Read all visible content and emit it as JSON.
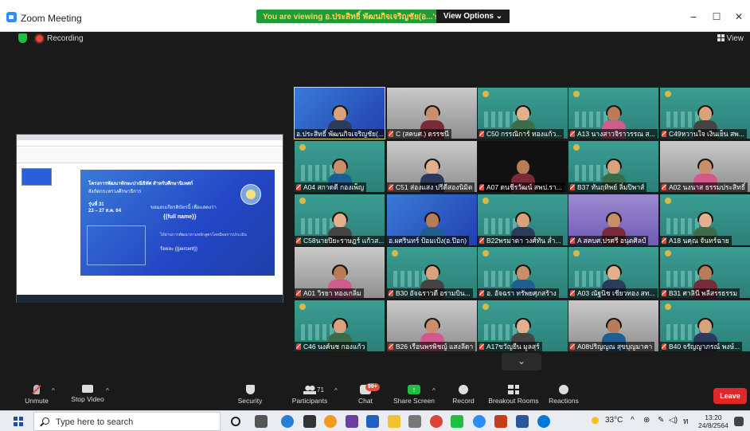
{
  "window": {
    "title": "Zoom Meeting",
    "minimize": "−",
    "maximize": "☐",
    "close": "✕"
  },
  "share_banner": {
    "text": "You are viewing อ.ประสิทธิ์ พัฒนกิจเจริญชัย(อ...'s screen",
    "options": "View Options ⌄"
  },
  "recording": {
    "label": "Recording"
  },
  "view": {
    "label": "View"
  },
  "slide": {
    "title": "โครงการพัฒนาทักษะปาณิธิทัศ สำหรับศึกษานิเทศก์",
    "subtitle": "สังกัดกระทรวงศึกษาธิการ",
    "round": "รุ่นที่ 31",
    "date": "23 – 27 ส.ค. 64",
    "cert_text": "ขอมอบเกียรติบัตรนี้ เพื่อแสดงว่า",
    "name_placeholder": "{{full name}}",
    "note": "ได้ผ่านการพัฒนาตามหลักสูตรโดยมีผลการประเมิน",
    "percent_label": "ร้อยละ",
    "percent_placeholder": "{{percent}}"
  },
  "participants": [
    {
      "name": "อ.ประสิทธิ์ พัฒนกิจเจริญชัย(...",
      "bg": "blue",
      "active": true,
      "muted": false
    },
    {
      "name": "C (สคบศ.) ดรรชนี",
      "bg": "room",
      "muted": true
    },
    {
      "name": "C50 กรรณิการ์ ทองแก้ว...",
      "bg": "vbg",
      "muted": true
    },
    {
      "name": "A13 นางสาวจิราวรรณ ส...",
      "bg": "vbg",
      "muted": true
    },
    {
      "name": "C49หวานใจ เงินเย็น สพ...",
      "bg": "vbg",
      "muted": true
    },
    {
      "name": "A04 สกาดดี กองเพ็ญ",
      "bg": "vbg",
      "muted": true
    },
    {
      "name": "C51 ส่องแสง ปรีดีสองนิมิต",
      "bg": "room",
      "muted": true
    },
    {
      "name": "A07 ดนชีรวัฒน์ สพป.รา...",
      "bg": "dark",
      "muted": true
    },
    {
      "name": "B37 ทันฤทิพย์ ลิ่มปิพาส์",
      "bg": "vbg",
      "muted": true
    },
    {
      "name": "A02 นงนาส ธรรมประสิทธิ์",
      "bg": "room",
      "muted": true
    },
    {
      "name": "C58นายปิยะราษฎร์ แก้วส...",
      "bg": "vbg",
      "muted": true
    },
    {
      "name": "อ.ผศรินทร์ ป้อมเป้ง(อ.ป๊อก)",
      "bg": "blue",
      "muted": false
    },
    {
      "name": "B22พรมาตา วงศ์ทัน ล่ำ...",
      "bg": "vbg",
      "muted": true
    },
    {
      "name": "A สคบศ.ปรศรี อนุตศิลป์",
      "bg": "purple",
      "muted": true
    },
    {
      "name": "A18 นคุณ จันทร์ฉาย",
      "bg": "vbg",
      "muted": true
    },
    {
      "name": "A01 วิรยา ทองเกลิ่ม",
      "bg": "room",
      "muted": true
    },
    {
      "name": "B30 อัจฉราวดี อรามบิน...",
      "bg": "vbg",
      "muted": true
    },
    {
      "name": "อ. อัจฉรา ทรัพยศุภสร้าง",
      "bg": "vbg",
      "muted": true
    },
    {
      "name": "A03 ณัฐนิช เชียวทอง สท...",
      "bg": "vbg",
      "muted": true
    },
    {
      "name": "B31 ศาลินี พลีสรรธรรม",
      "bg": "vbg",
      "muted": true
    },
    {
      "name": "C46 นงค์นช กองแก้ว",
      "bg": "vbg",
      "muted": true
    },
    {
      "name": "B26 เรือนพรพิชญ์ แสงลีดา",
      "bg": "room",
      "muted": true
    },
    {
      "name": "A17ขวัญยืน มูลสุร์",
      "bg": "vbg",
      "muted": true
    },
    {
      "name": "A08ปริญญณ สุขบุญมาคา",
      "bg": "room",
      "muted": true
    },
    {
      "name": "B40 จรัญญาภรณ์ พงษ์...",
      "bg": "vbg",
      "muted": true
    }
  ],
  "toolbar": {
    "unmute": "Unmute",
    "stop_video": "Stop Video",
    "security": "Security",
    "participants": "Participants",
    "participants_count": "71",
    "chat": "Chat",
    "chat_badge": "99+",
    "share_screen": "Share Screen",
    "record": "Record",
    "breakout": "Breakout Rooms",
    "reactions": "Reactions",
    "leave": "Leave"
  },
  "taskbar": {
    "search_placeholder": "Type here to search",
    "temperature": "33°C",
    "time": "13:20",
    "date": "24/8/2564"
  },
  "colors": {
    "accent": "#2D8CFF",
    "share_green": "#1fbf45",
    "leave_red": "#e02828",
    "active_border": "#e3e35a"
  }
}
